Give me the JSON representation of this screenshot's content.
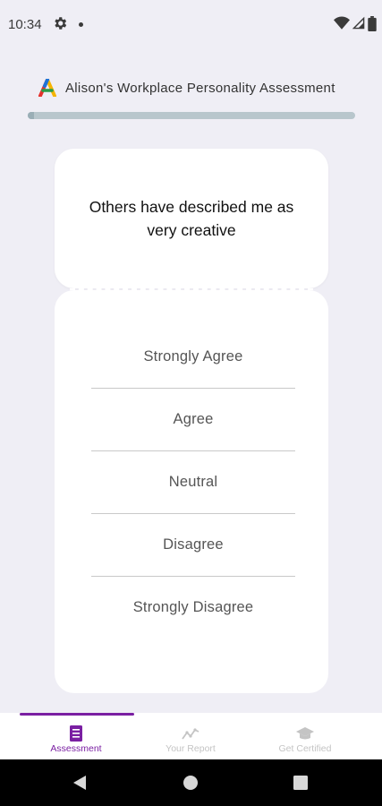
{
  "status_bar": {
    "time": "10:34",
    "icons": [
      "settings-gear-icon",
      "notification-dot-icon",
      "wifi-icon",
      "cell-signal-icon",
      "battery-icon"
    ]
  },
  "header": {
    "title": "Alison's Workplace Personality Assessment",
    "logo_icon": "alison-logo-icon",
    "progress_fraction": 0.02
  },
  "question": {
    "text": "Others have described me as very creative"
  },
  "answers": [
    {
      "label": "Strongly Agree"
    },
    {
      "label": "Agree"
    },
    {
      "label": "Neutral"
    },
    {
      "label": "Disagree"
    },
    {
      "label": "Strongly Disagree"
    }
  ],
  "bottom_nav": {
    "items": [
      {
        "label": "Assessment",
        "icon": "document-icon",
        "active": true
      },
      {
        "label": "Your Report",
        "icon": "trend-line-icon",
        "active": false
      },
      {
        "label": "Get Certified",
        "icon": "graduation-cap-icon",
        "active": false
      }
    ]
  },
  "colors": {
    "background": "#efeef5",
    "accent": "#7a1fa2",
    "inactive": "#c4c4c4",
    "progress_track": "#b8c6cc"
  },
  "system_nav": {
    "icons": [
      "back-icon",
      "home-icon",
      "recents-icon"
    ]
  }
}
